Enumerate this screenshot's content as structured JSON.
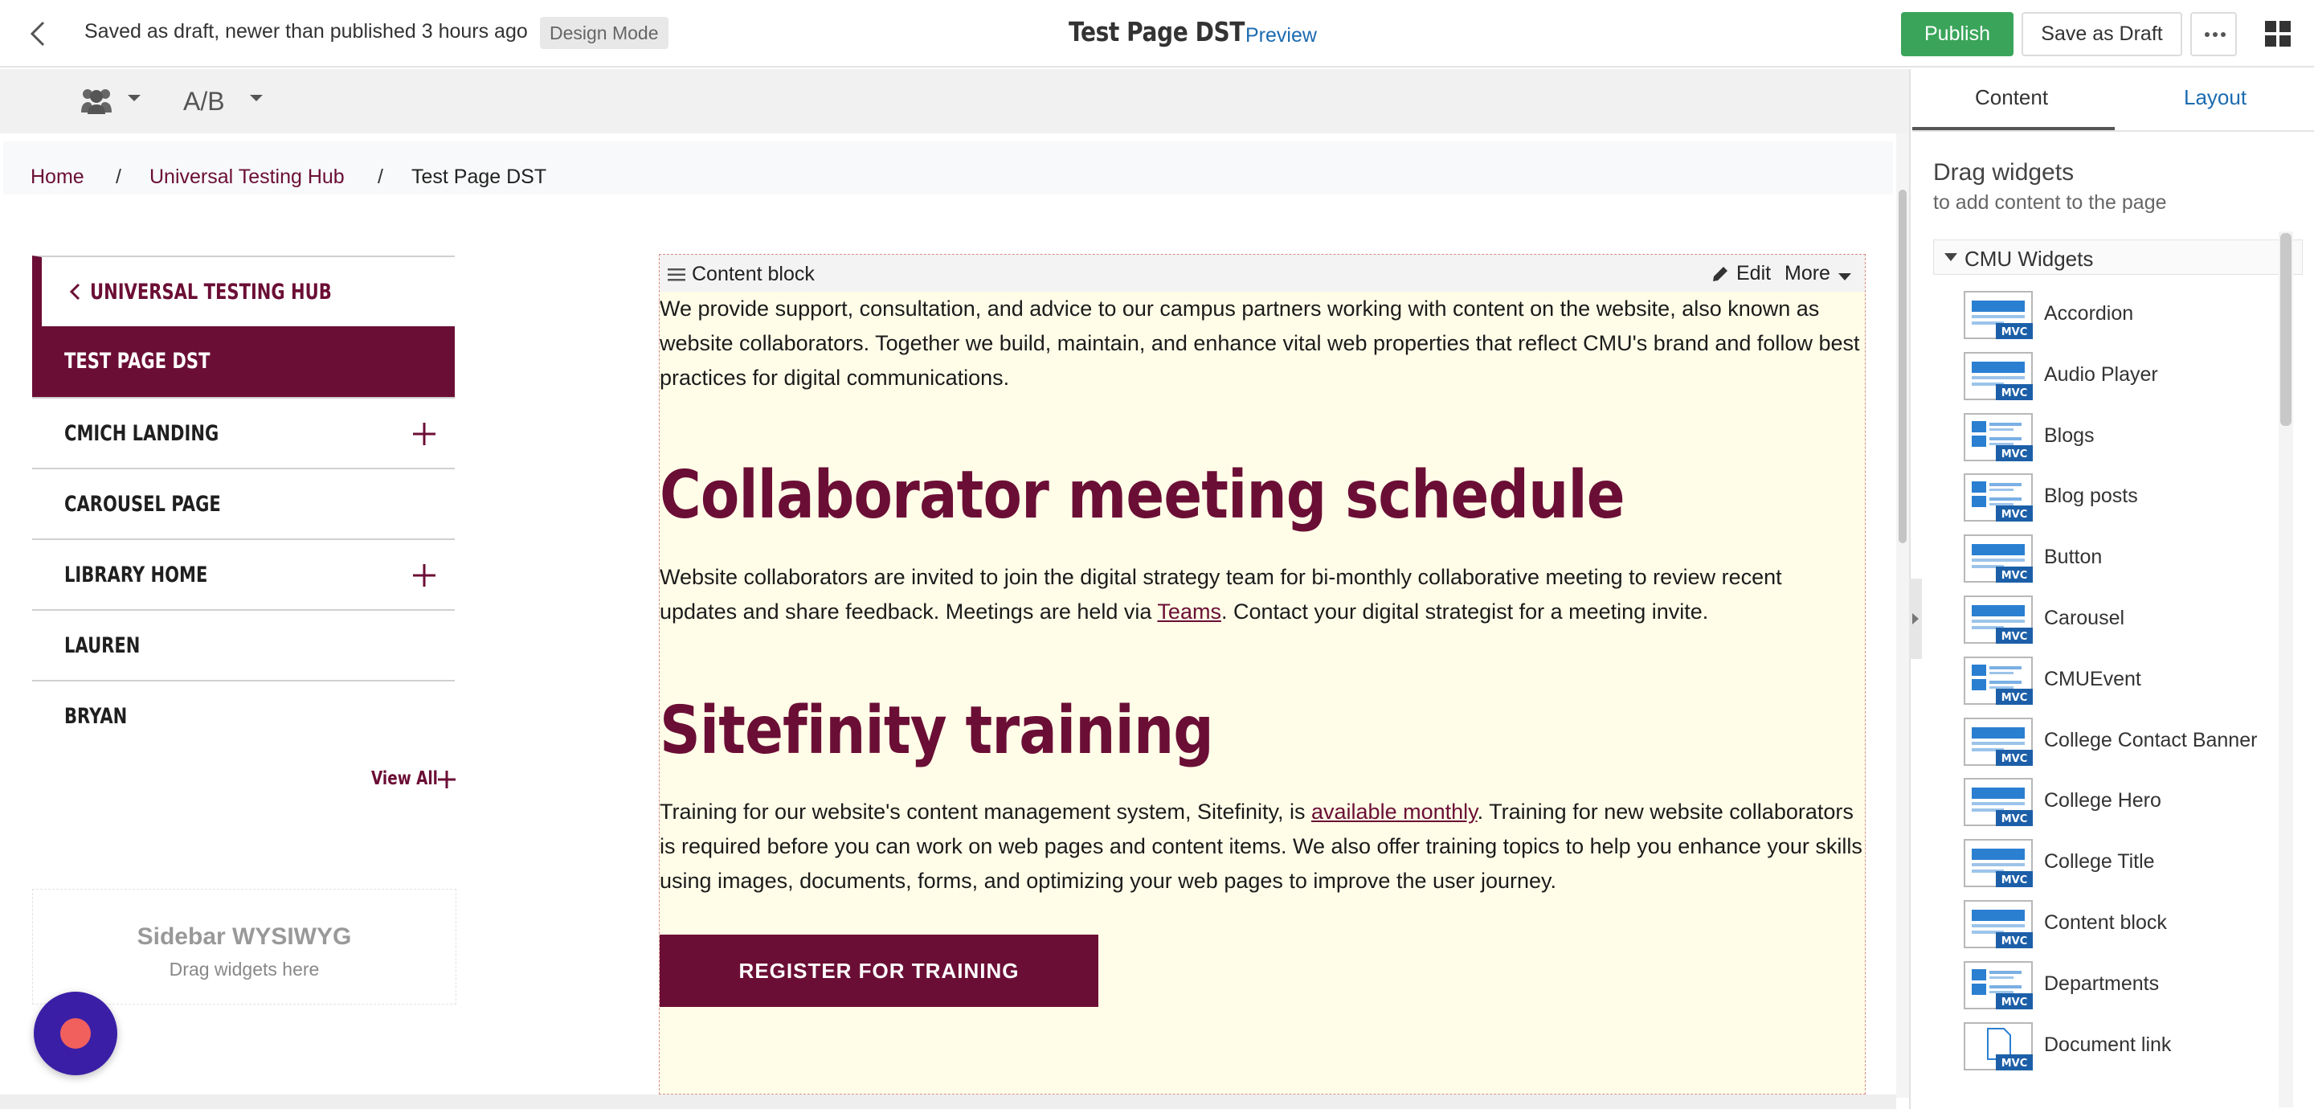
{
  "topbar": {
    "status": "Saved as draft, newer than published 3 hours ago",
    "mode_badge": "Design Mode",
    "page_title": "Test Page DST",
    "preview": "Preview",
    "publish": "Publish",
    "save_draft": "Save as Draft"
  },
  "toolbar": {
    "ab_label": "A/B"
  },
  "breadcrumb": {
    "home": "Home",
    "sep": "/",
    "parent": "Universal Testing Hub",
    "current": "Test Page DST"
  },
  "sidenav": {
    "parent": "Universal Testing Hub",
    "items": [
      {
        "label": "Test Page DST",
        "active": true,
        "expandable": false
      },
      {
        "label": "CMICH Landing",
        "active": false,
        "expandable": true
      },
      {
        "label": "Carousel Page",
        "active": false,
        "expandable": false
      },
      {
        "label": "Library Home",
        "active": false,
        "expandable": true
      },
      {
        "label": "Lauren",
        "active": false,
        "expandable": false
      },
      {
        "label": "Bryan",
        "active": false,
        "expandable": false
      }
    ],
    "view_all": "View All"
  },
  "sidebar_zone": {
    "title": "Sidebar WYSIWYG",
    "hint": "Drag widgets here"
  },
  "content_block": {
    "title": "Content block",
    "edit": "Edit",
    "more": "More",
    "intro": "We provide support, consultation, and advice to our campus partners working with content on the website, also known as website collaborators. Together we build, maintain, and enhance vital web properties that reflect CMU's brand and follow best practices for digital communications.",
    "heading1": "Collaborator meeting schedule",
    "para1_before": "Website collaborators are invited to join the digital strategy team for bi-monthly collaborative meeting to review recent updates and share feedback. Meetings are held via ",
    "para1_link": "Teams",
    "para1_after": ". Contact your digital strategist for a meeting invite.",
    "heading2": "Sitefinity training",
    "para2_before": "Training for our website's content management system, Sitefinity, is ",
    "para2_link": "available monthly",
    "para2_after": ". Training for new website collaborators is required before you can work on web pages and content items. We also offer training topics to help you enhance your skills using images, documents, forms, and optimizing your web pages to improve the user journey.",
    "button": "REGISTER FOR TRAINING"
  },
  "right_panel": {
    "tab_content": "Content",
    "tab_layout": "Layout",
    "drag_title": "Drag widgets",
    "drag_sub": "to add content to the page",
    "group": "CMU Widgets",
    "widgets": [
      "Accordion",
      "Audio Player",
      "Blogs",
      "Blog posts",
      "Button",
      "Carousel",
      "CMUEvent",
      "College Contact Banner",
      "College Hero",
      "College Title",
      "Content block",
      "Departments",
      "Document link"
    ],
    "widget_badge": "MVC"
  },
  "colors": {
    "brand": "#6b0e35",
    "publish": "#3aa55a",
    "link": "#1b6bb0",
    "content_bg": "#fffde8"
  }
}
